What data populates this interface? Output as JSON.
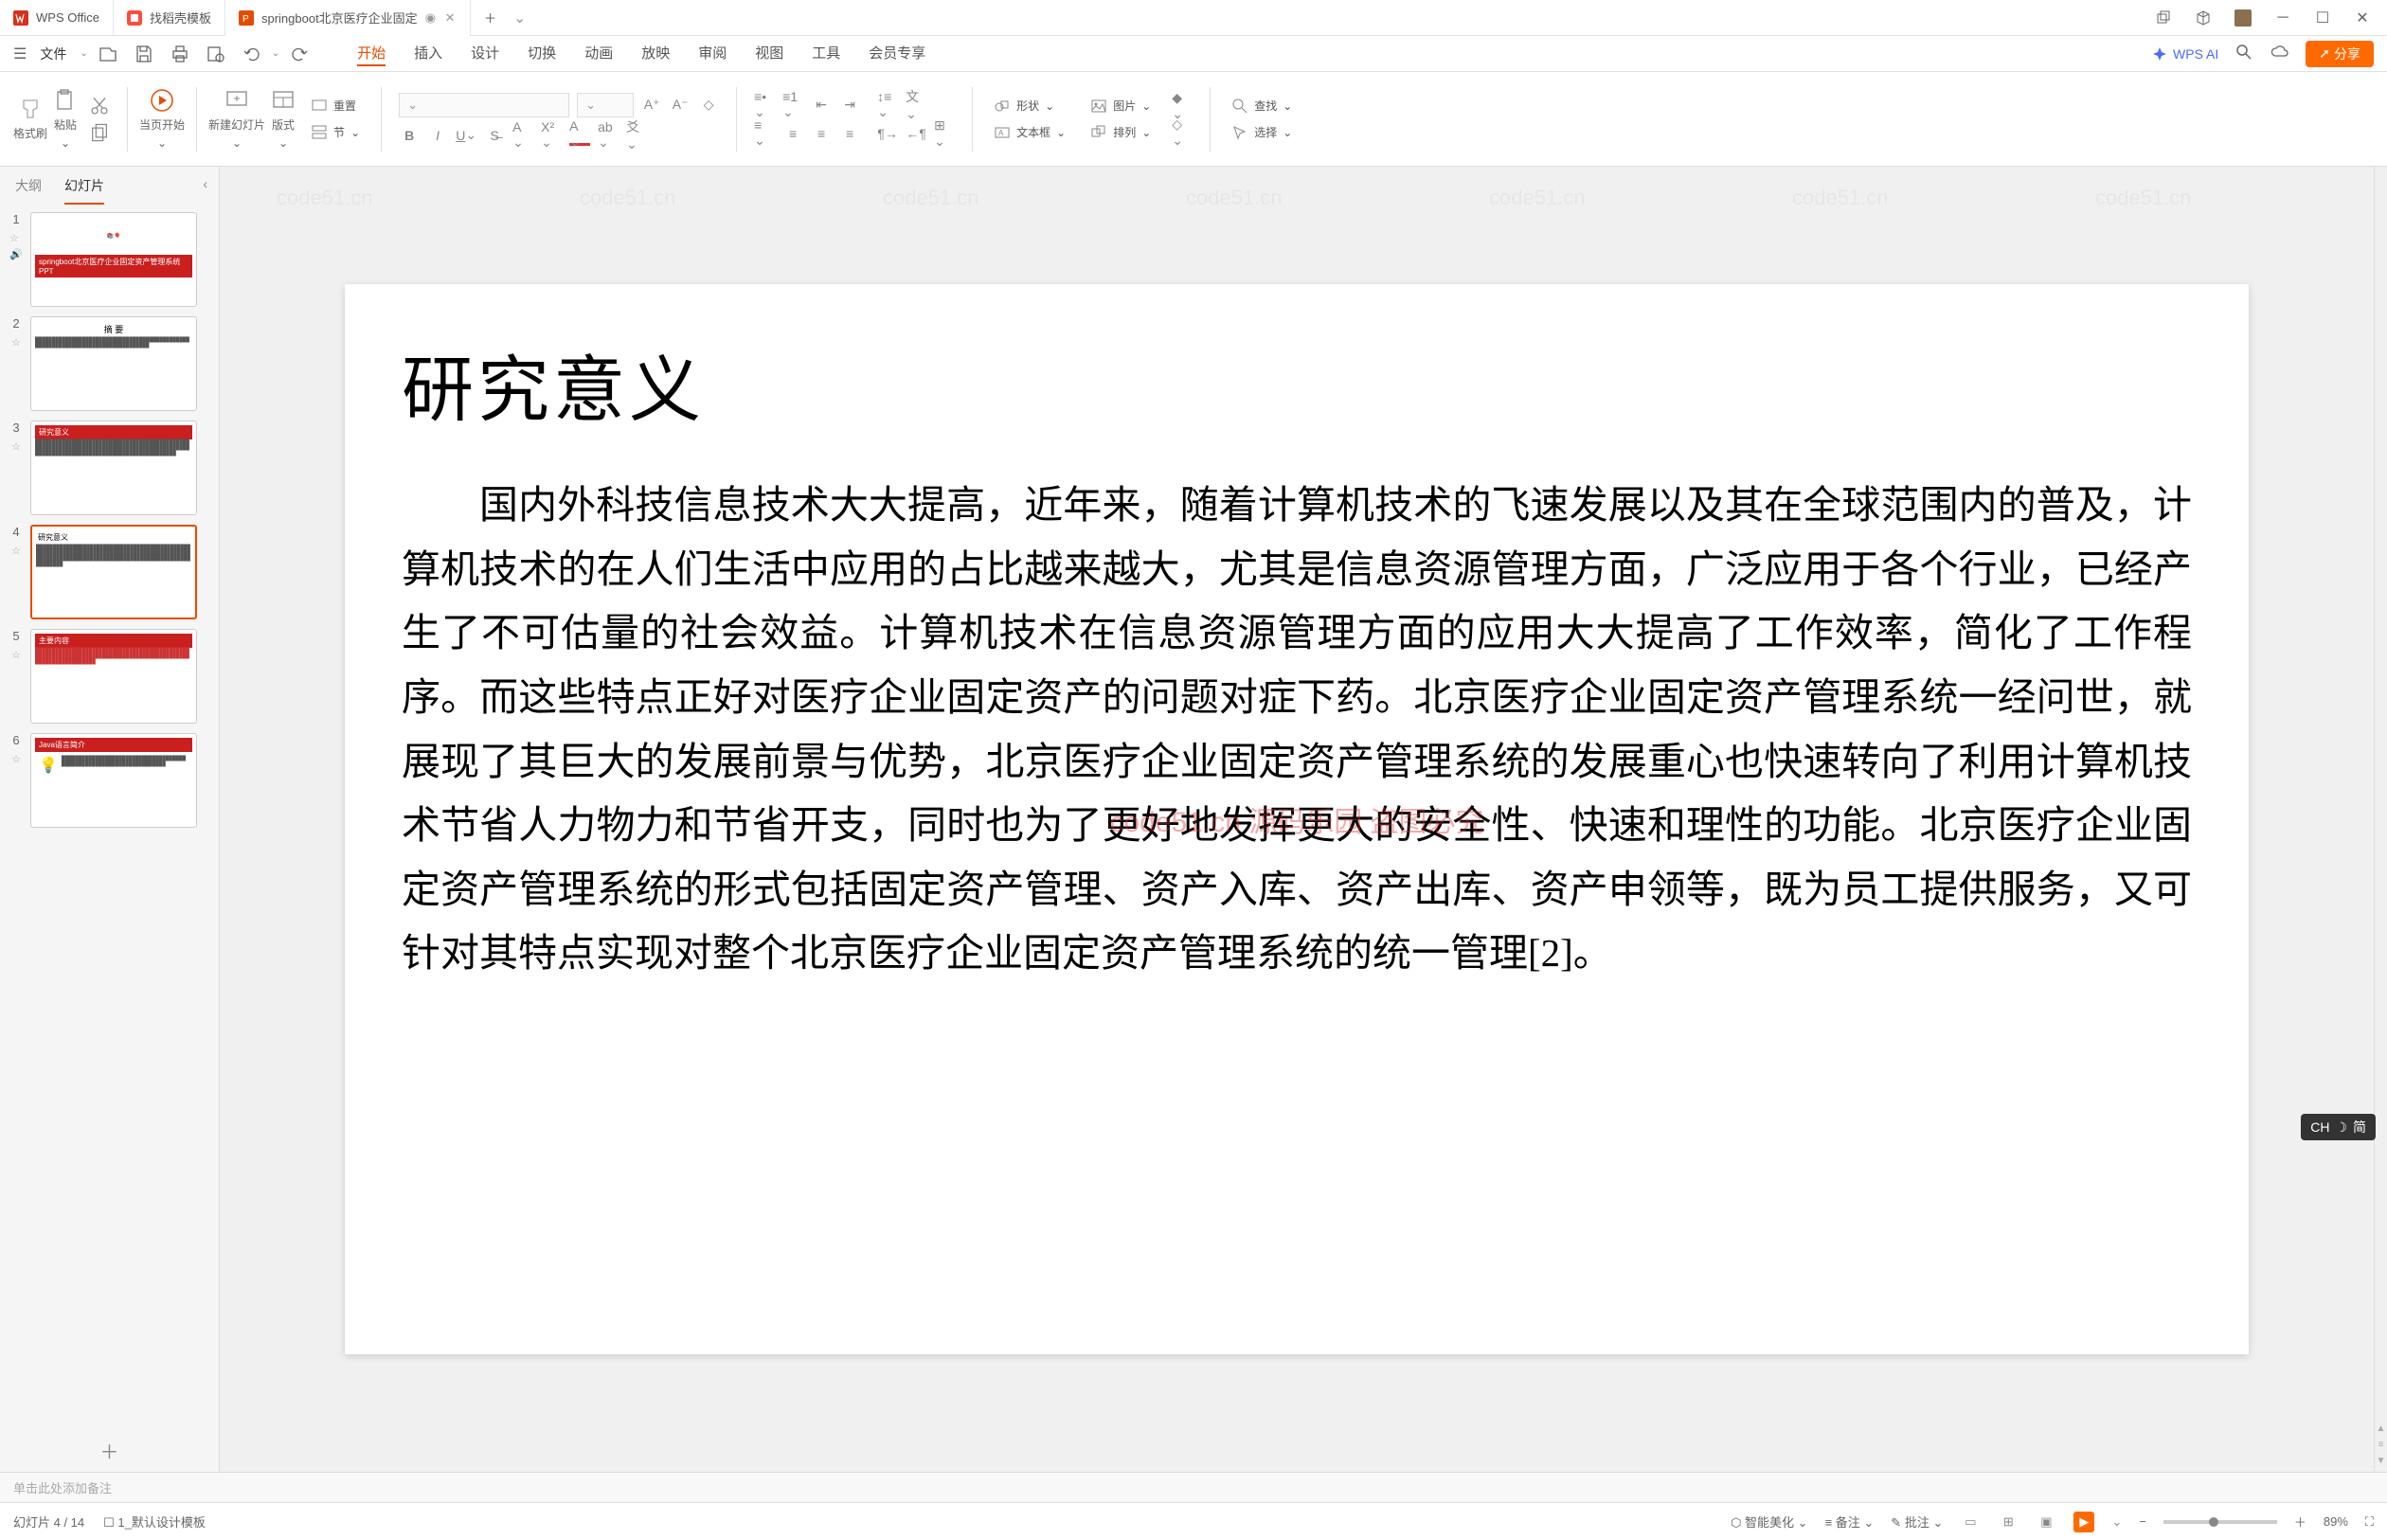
{
  "titlebar": {
    "tab1_label": "WPS Office",
    "tab2_label": "找稻壳模板",
    "tab3_label": "springboot北京医疗企业固定"
  },
  "menubar": {
    "file": "文件",
    "tabs": {
      "start": "开始",
      "insert": "插入",
      "design": "设计",
      "transition": "切换",
      "animation": "动画",
      "slideshow": "放映",
      "review": "审阅",
      "view": "视图",
      "tools": "工具",
      "member": "会员专享"
    },
    "ai": "WPS AI",
    "share": "分享"
  },
  "ribbon": {
    "format_brush": "格式刷",
    "paste": "粘贴",
    "from_current": "当页开始",
    "new_slide": "新建幻灯片",
    "layout": "版式",
    "reset": "重置",
    "section": "节",
    "shape": "形状",
    "picture": "图片",
    "textbox": "文本框",
    "arrange": "排列",
    "find": "查找",
    "select": "选择"
  },
  "sidebar": {
    "outline": "大纲",
    "slides": "幻灯片",
    "items": [
      {
        "n": "1",
        "title": "springboot北京医疗企业固定资产管理系统 PPT"
      },
      {
        "n": "2",
        "title": "摘 要"
      },
      {
        "n": "3",
        "title": "研究意义"
      },
      {
        "n": "4",
        "title": "研究意义"
      },
      {
        "n": "5",
        "title": "主要内容"
      },
      {
        "n": "6",
        "title": "Java语言简介"
      }
    ]
  },
  "slide": {
    "title": "研究意义",
    "body": "国内外科技信息技术大大提高，近年来，随着计算机技术的飞速发展以及其在全球范围内的普及，计算机技术的在人们生活中应用的占比越来越大，尤其是信息资源管理方面，广泛应用于各个行业，已经产生了不可估量的社会效益。计算机技术在信息资源管理方面的应用大大提高了工作效率，简化了工作程序。而这些特点正好对医疗企业固定资产的问题对症下药。北京医疗企业固定资产管理系统一经问世，就展现了其巨大的发展前景与优势，北京医疗企业固定资产管理系统的发展重心也快速转向了利用计算机技术节省人力物力和节省开支，同时也为了更好地发挥更大的安全性、快速和理性的功能。北京医疗企业固定资产管理系统的形式包括固定资产管理、资产入库、资产出库、资产申领等，既为员工提供服务，又可针对其特点实现对整个北京医疗企业固定资产管理系统的统一管理[2]。",
    "watermark": "code51.cn",
    "center_wm": "code51.cn 源码乐园 盗图必究"
  },
  "notes_placeholder": "单击此处添加备注",
  "statusbar": {
    "slide_count": "幻灯片 4 / 14",
    "design": "1_默认设计模板",
    "beautify": "智能美化",
    "notes": "备注",
    "comments": "批注",
    "zoom": "89%"
  },
  "ime": {
    "lang": "CH",
    "mode": "简"
  }
}
